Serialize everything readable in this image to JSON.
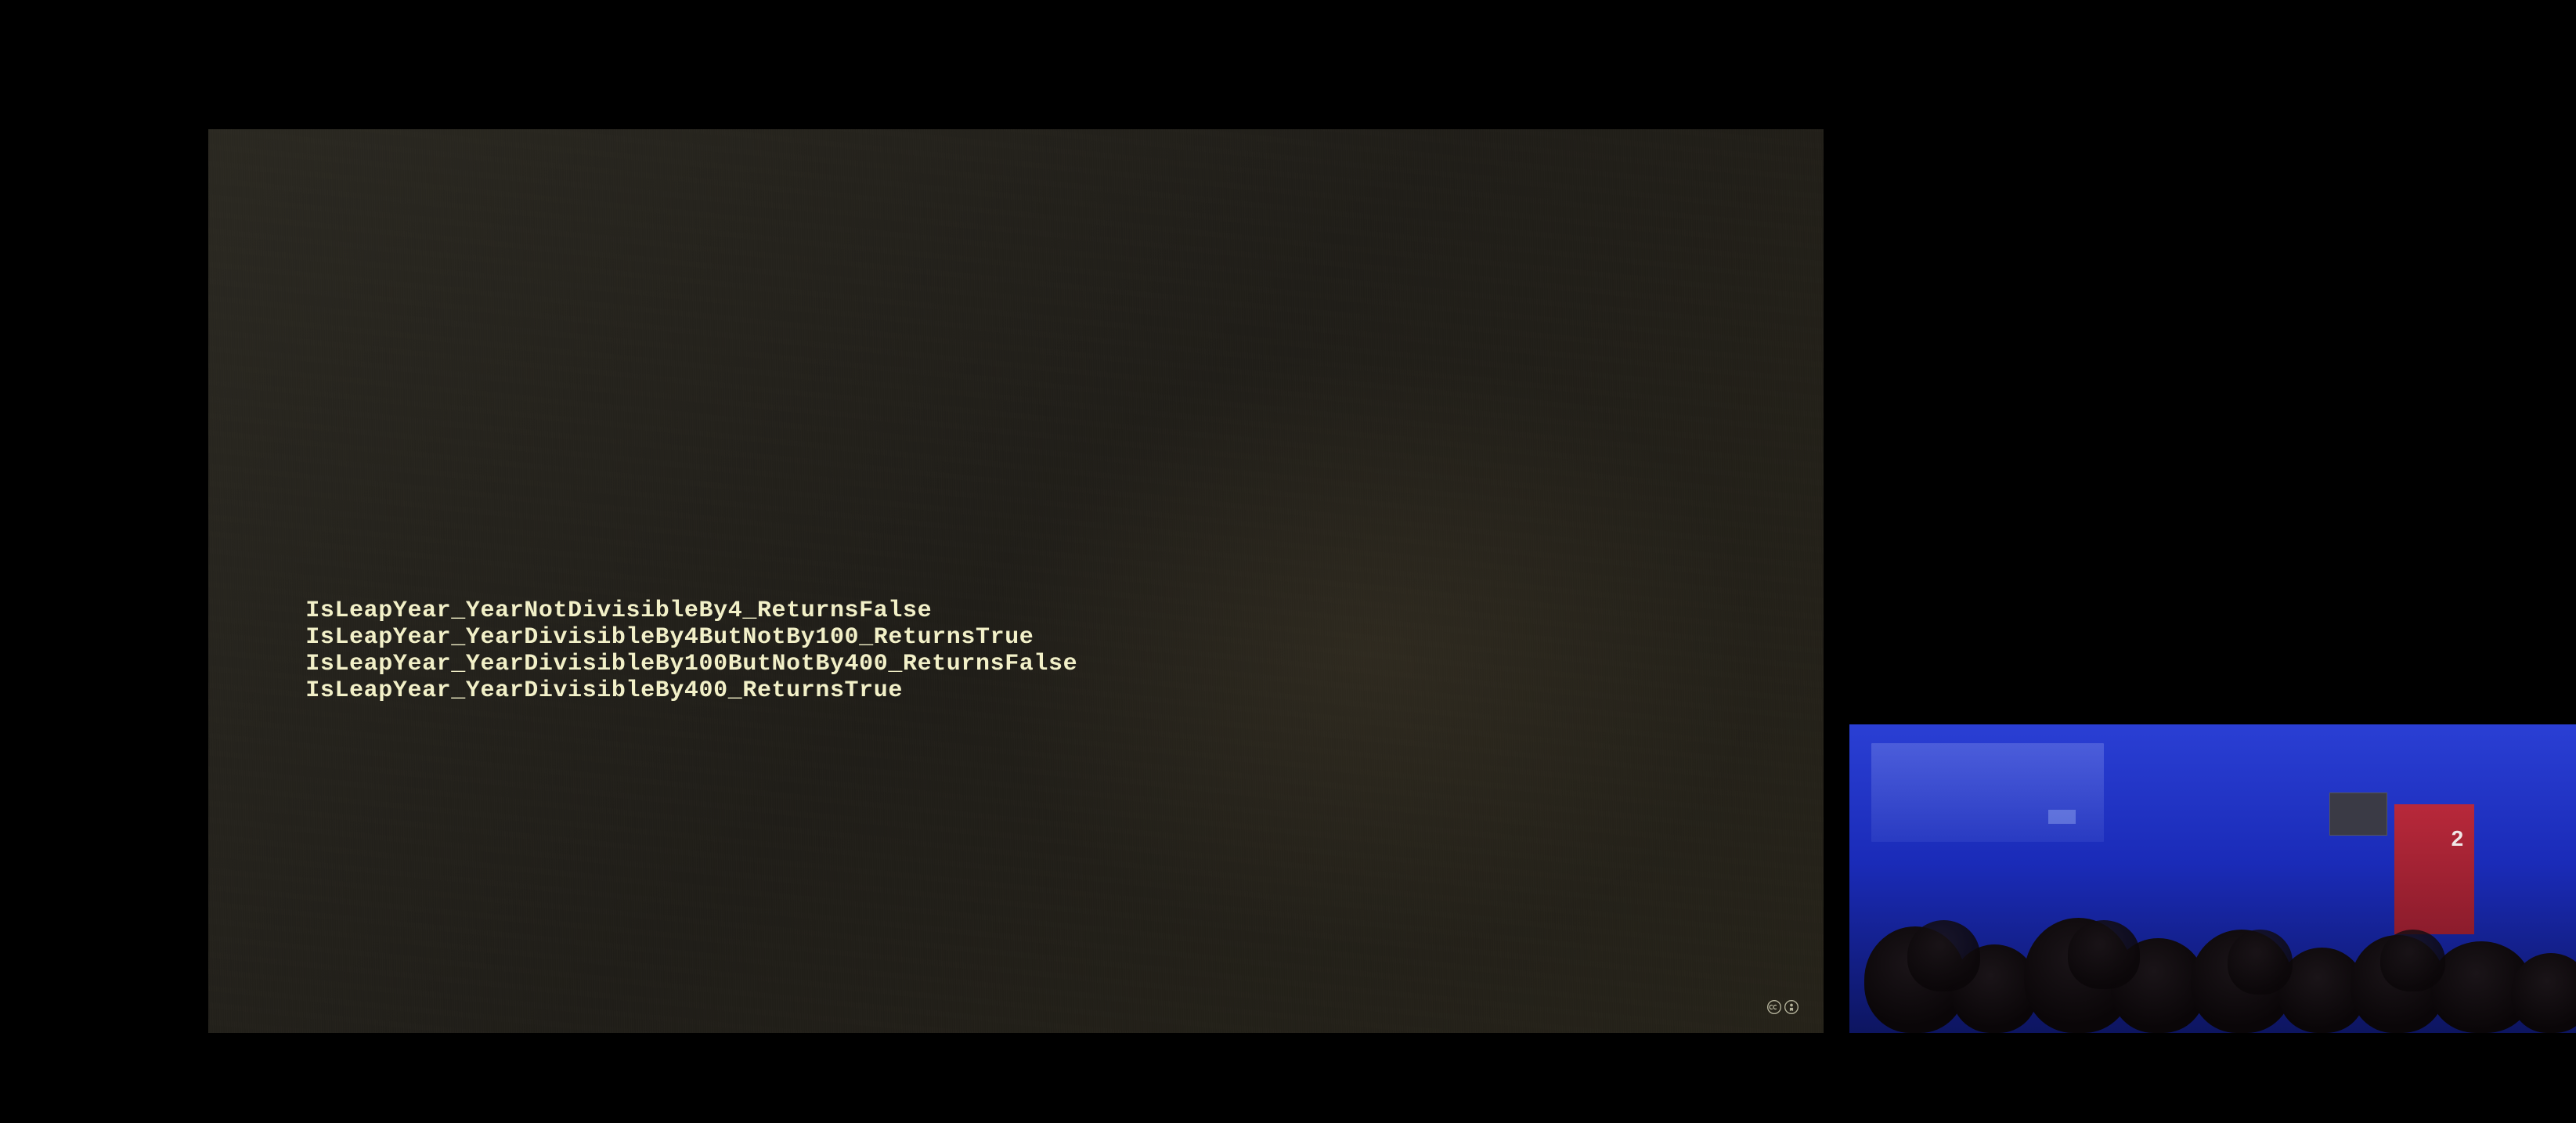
{
  "slide": {
    "lines": [
      "IsLeapYear_YearNotDivisibleBy4_ReturnsFalse",
      "IsLeapYear_YearDivisibleBy4ButNotBy100_ReturnsTrue",
      "IsLeapYear_YearDivisibleBy100ButNotBy400_ReturnsFalse",
      "IsLeapYear_YearDivisibleBy400_ReturnsTrue"
    ],
    "license_icon": "cc-by"
  },
  "pip": {
    "podium_number": "2"
  }
}
